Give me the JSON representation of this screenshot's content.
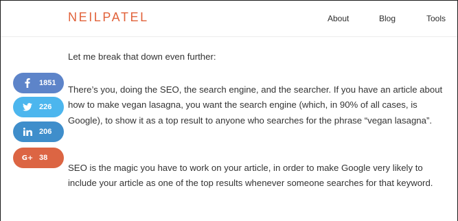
{
  "header": {
    "logo": "NEILPATEL",
    "nav": [
      {
        "label": "About"
      },
      {
        "label": "Blog"
      },
      {
        "label": "Tools"
      }
    ]
  },
  "share": {
    "facebook": {
      "icon": "facebook-icon",
      "count": "1851",
      "color": "#5d84c9"
    },
    "twitter": {
      "icon": "twitter-icon",
      "count": "226",
      "color": "#4cb6ee"
    },
    "linkedin": {
      "icon": "linkedin-icon",
      "count": "206",
      "color": "#3f8ecb"
    },
    "googleplus": {
      "icon": "google-plus-icon",
      "glyph": "G+",
      "count": "38",
      "color": "#dc6543"
    }
  },
  "article": {
    "intro": "Let me break that down even further:",
    "paragraph1": "There’s you, doing the SEO, the search engine, and the searcher. If you have an article about how to make vegan lasagna, you want the search engine (which, in 90% of all cases, is Google), to show it as a top result to anyone who searches for the phrase “vegan lasagna”.",
    "paragraph2": "SEO is the magic you have to work on your article, in order to make Google very likely to include your article as one of the top results whenever someone searches for that keyword."
  },
  "colors": {
    "brand": "#e1623a",
    "text": "#333333"
  }
}
